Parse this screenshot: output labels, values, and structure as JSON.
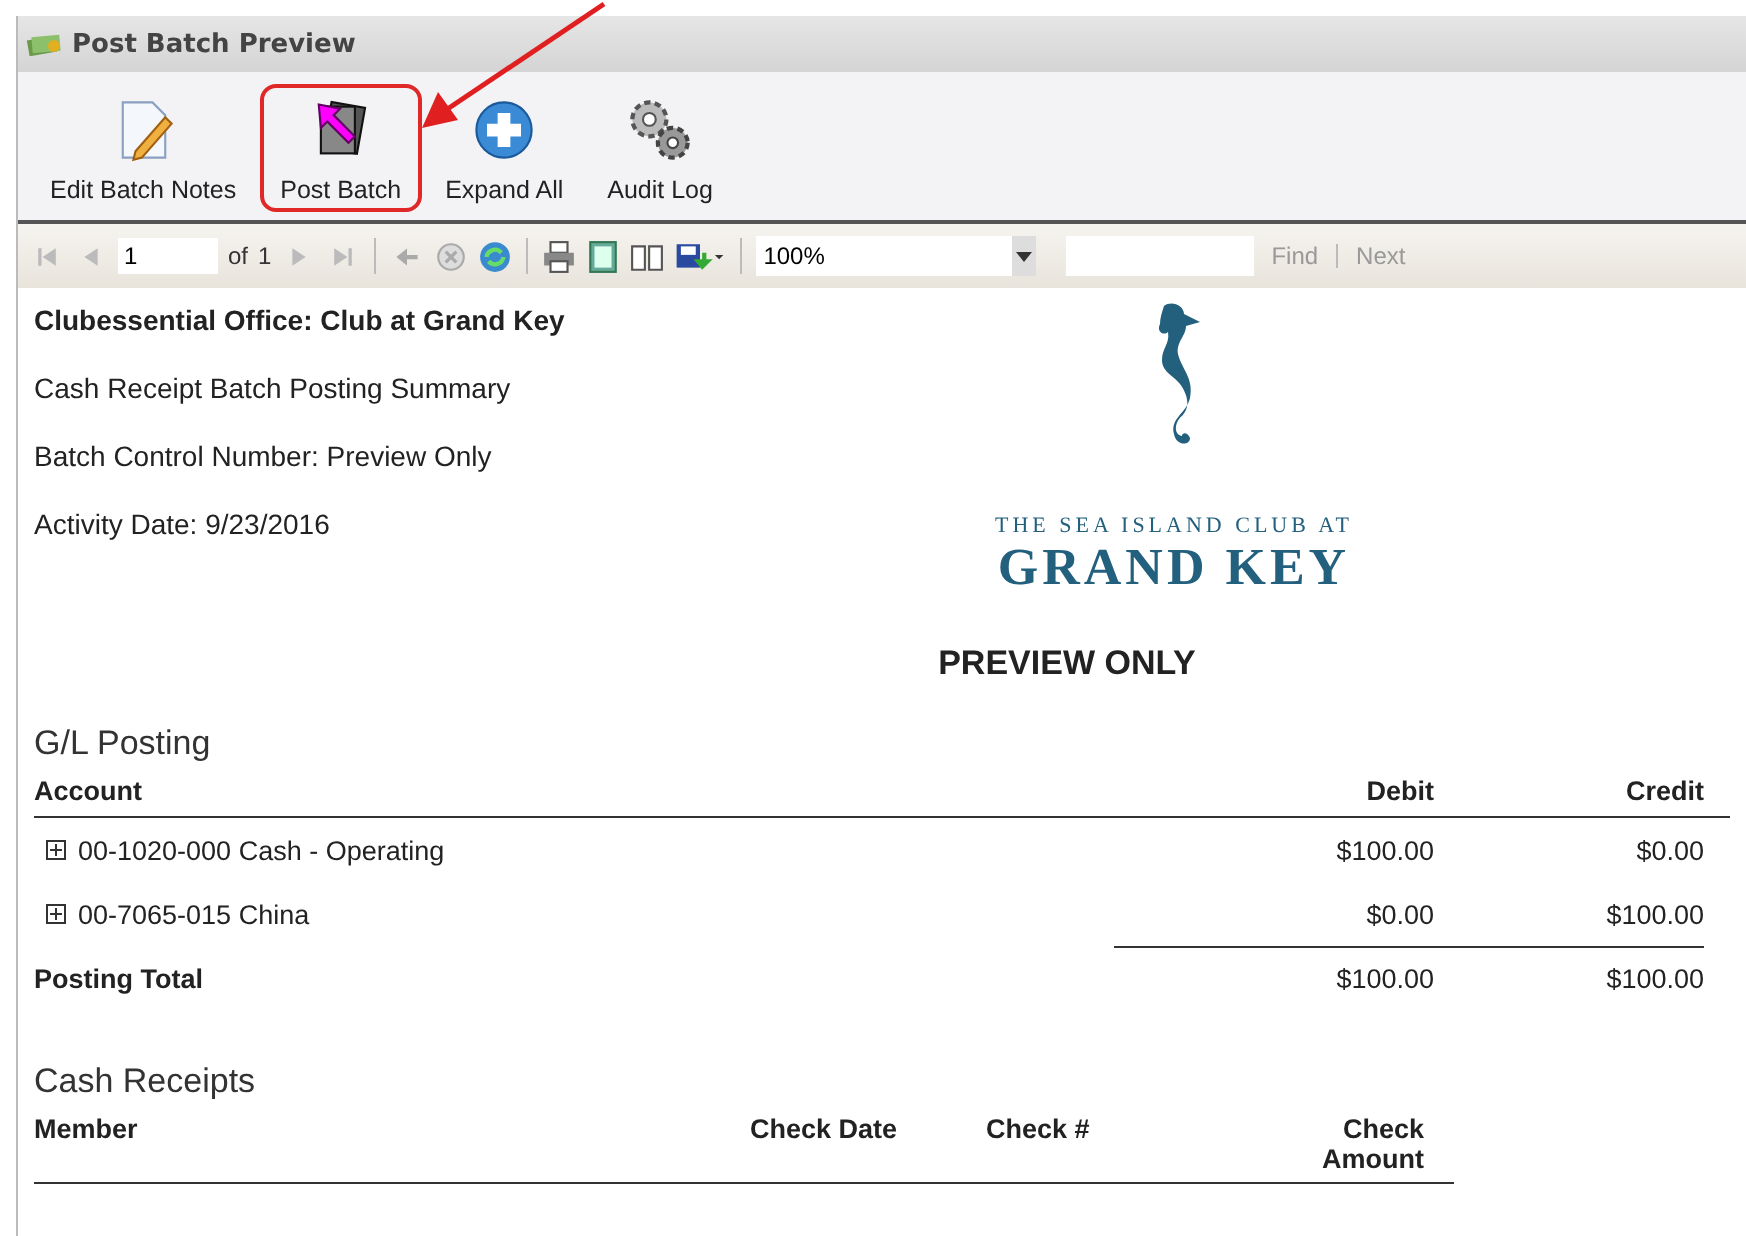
{
  "window": {
    "title": "Post Batch Preview"
  },
  "toolbar": [
    {
      "label": "Edit Batch Notes",
      "kind": "notes",
      "highlighted": false
    },
    {
      "label": "Post Batch",
      "kind": "post",
      "highlighted": true
    },
    {
      "label": "Expand All",
      "kind": "expand",
      "highlighted": false
    },
    {
      "label": "Audit Log",
      "kind": "gears",
      "highlighted": false
    }
  ],
  "navigator": {
    "page": "1",
    "of_label": "of",
    "page_count": "1",
    "zoom": "100%",
    "find": "Find",
    "next": "Next"
  },
  "report": {
    "header_lines": [
      {
        "text": "Clubessential Office: Club at Grand Key",
        "bold": true
      },
      {
        "text": "Cash Receipt Batch Posting Summary",
        "bold": false
      },
      {
        "text": "Batch Control Number: Preview Only",
        "bold": false
      },
      {
        "text": "Activity Date: 9/23/2016",
        "bold": false
      }
    ],
    "logo": {
      "tagline": "THE SEA ISLAND CLUB AT",
      "name": "GRAND KEY"
    },
    "banner": "PREVIEW ONLY",
    "gl": {
      "title": "G/L Posting",
      "columns": [
        "Account",
        "Debit",
        "Credit"
      ],
      "rows": [
        {
          "account": "00-1020-000 Cash - Operating",
          "debit": "$100.00",
          "credit": "$0.00",
          "expanded": false
        },
        {
          "account": "00-7065-015 China",
          "debit": "$0.00",
          "credit": "$100.00",
          "expanded": false
        }
      ],
      "total": {
        "label": "Posting Total",
        "debit": "$100.00",
        "credit": "$100.00"
      }
    },
    "receipts": {
      "title": "Cash Receipts",
      "columns": [
        "Member",
        "Check Date",
        "Check #",
        "Check Amount"
      ]
    }
  }
}
